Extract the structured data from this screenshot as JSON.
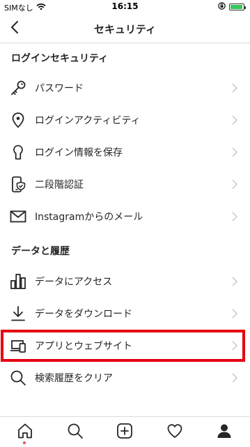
{
  "status_bar": {
    "carrier": "SIMなし",
    "time": "16:15",
    "battery_level": 0.95,
    "battery_color": "#34c759"
  },
  "header": {
    "title": "セキュリティ",
    "back_icon": "chevron-left-icon"
  },
  "sections": [
    {
      "title": "ログインセキュリティ",
      "items": [
        {
          "label": "パスワード",
          "icon": "key-icon"
        },
        {
          "label": "ログインアクティビティ",
          "icon": "location-pin-icon"
        },
        {
          "label": "ログイン情報を保存",
          "icon": "keyhole-icon"
        },
        {
          "label": "二段階認証",
          "icon": "phone-shield-icon"
        },
        {
          "label": "Instagramからのメール",
          "icon": "mail-icon"
        }
      ]
    },
    {
      "title": "データと履歴",
      "items": [
        {
          "label": "データにアクセス",
          "icon": "bar-chart-icon"
        },
        {
          "label": "データをダウンロード",
          "icon": "download-icon"
        },
        {
          "label": "アプリとウェブサイト",
          "icon": "devices-icon",
          "highlighted": true
        },
        {
          "label": "検索履歴をクリア",
          "icon": "search-icon"
        }
      ]
    }
  ],
  "tab_bar": {
    "tabs": [
      "home-icon",
      "search-icon",
      "new-post-icon",
      "activity-heart-icon",
      "profile-icon"
    ],
    "notification_dot_color": "#ed4956"
  },
  "highlight_color": "#e60012"
}
